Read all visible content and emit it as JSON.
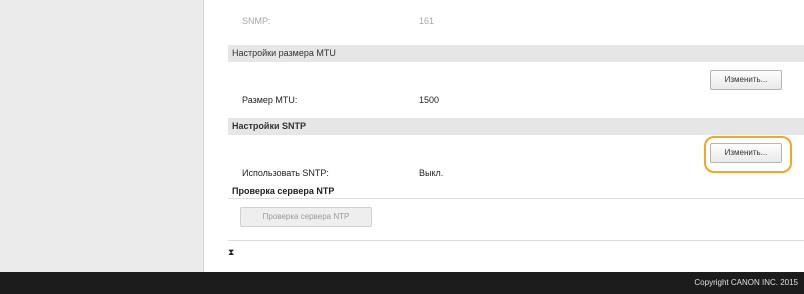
{
  "top_row": {
    "label": "SNMP:",
    "value": "161"
  },
  "mtu_section": {
    "heading": "Настройки размера MTU",
    "edit_label": "Изменить...",
    "rows": [
      {
        "label": "Размер MTU:",
        "value": "1500"
      }
    ]
  },
  "sntp_section": {
    "heading": "Настройки SNTP",
    "edit_label": "Изменить...",
    "rows": [
      {
        "label": "Использовать SNTP:",
        "value": "Выкл."
      }
    ],
    "ntp_check_heading": "Проверка сервера NTP",
    "ntp_check_button": "Проверка сервера NTP"
  },
  "back_to_top_icon": "top-arrow-icon",
  "footer": {
    "copyright": "Copyright CANON INC. 2015"
  },
  "colors": {
    "highlight": "#f5a623",
    "footer_bg": "#1c1c1c",
    "section_bg": "#e6e6e6"
  }
}
